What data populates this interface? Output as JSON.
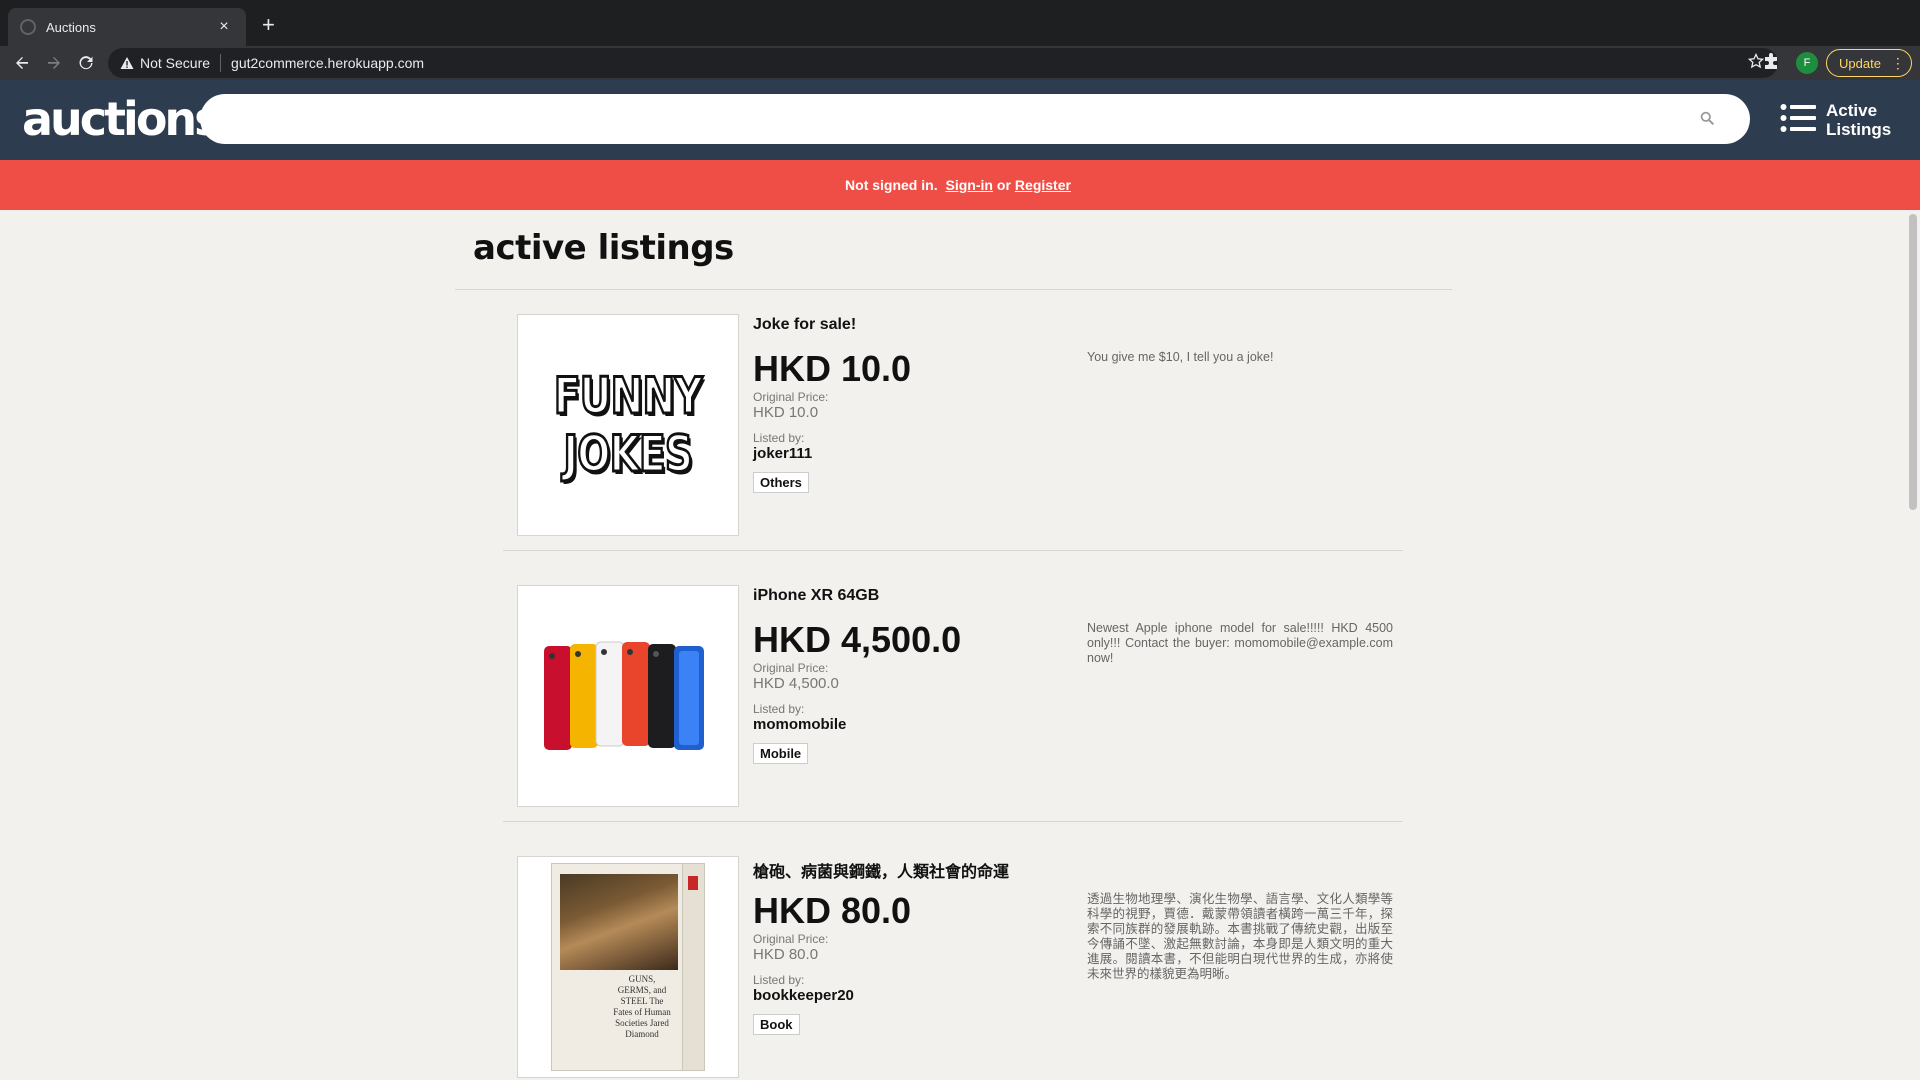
{
  "browser": {
    "tab_title": "Auctions",
    "security_label": "Not Secure",
    "url": "gut2commerce.herokuapp.com",
    "update_label": "Update",
    "profile_initial": "F"
  },
  "header": {
    "logo": "auctions",
    "search_placeholder": "",
    "menu_label_line1": "Active",
    "menu_label_line2": "Listings"
  },
  "banner": {
    "prefix": "Not signed in.",
    "signin": "Sign-in",
    "or": "or",
    "register": "Register"
  },
  "page": {
    "title": "active listings",
    "original_price_label": "Original Price:",
    "listed_by_label": "Listed by:"
  },
  "listings": [
    {
      "title": "Joke for sale!",
      "price": "HKD 10.0",
      "original_price": "HKD 10.0",
      "user": "joker111",
      "category": "Others",
      "description": "You give me $10, I tell you a joke!",
      "image_text_1": "FUNNY",
      "image_text_2": "JOKES"
    },
    {
      "title": "iPhone XR 64GB",
      "price": "HKD 4,500.0",
      "original_price": "HKD 4,500.0",
      "user": "momomobile",
      "category": "Mobile",
      "description": "Newest Apple iphone model for sale!!!!! HKD 4500 only!!! Contact the buyer: momomobile@example.com now!"
    },
    {
      "title": "槍砲、病菌與鋼鐵，人類社會的命運",
      "price": "HKD 80.0",
      "original_price": "HKD 80.0",
      "user": "bookkeeper20",
      "category": "Book",
      "description": "透過生物地理學、演化生物學、語言學、文化人類學等科學的視野，賈德．戴蒙帶領讀者橫跨一萬三千年，探索不同族群的發展軌跡。本書挑戰了傳統史觀，出版至今傳誦不墜、激起無數討論，本身即是人類文明的重大進展。閱讀本書，不但能明白現代世界的生成，亦將使未來世界的樣貌更為明晰。",
      "image_text": "GUNS, GERMS, and STEEL The Fates of Human Societies Jared Diamond"
    }
  ],
  "colors": {
    "header_bg": "#2d3d4f",
    "banner_bg": "#ee4e46",
    "page_bg": "#f2f1ee",
    "update_accent": "#fdd663"
  }
}
